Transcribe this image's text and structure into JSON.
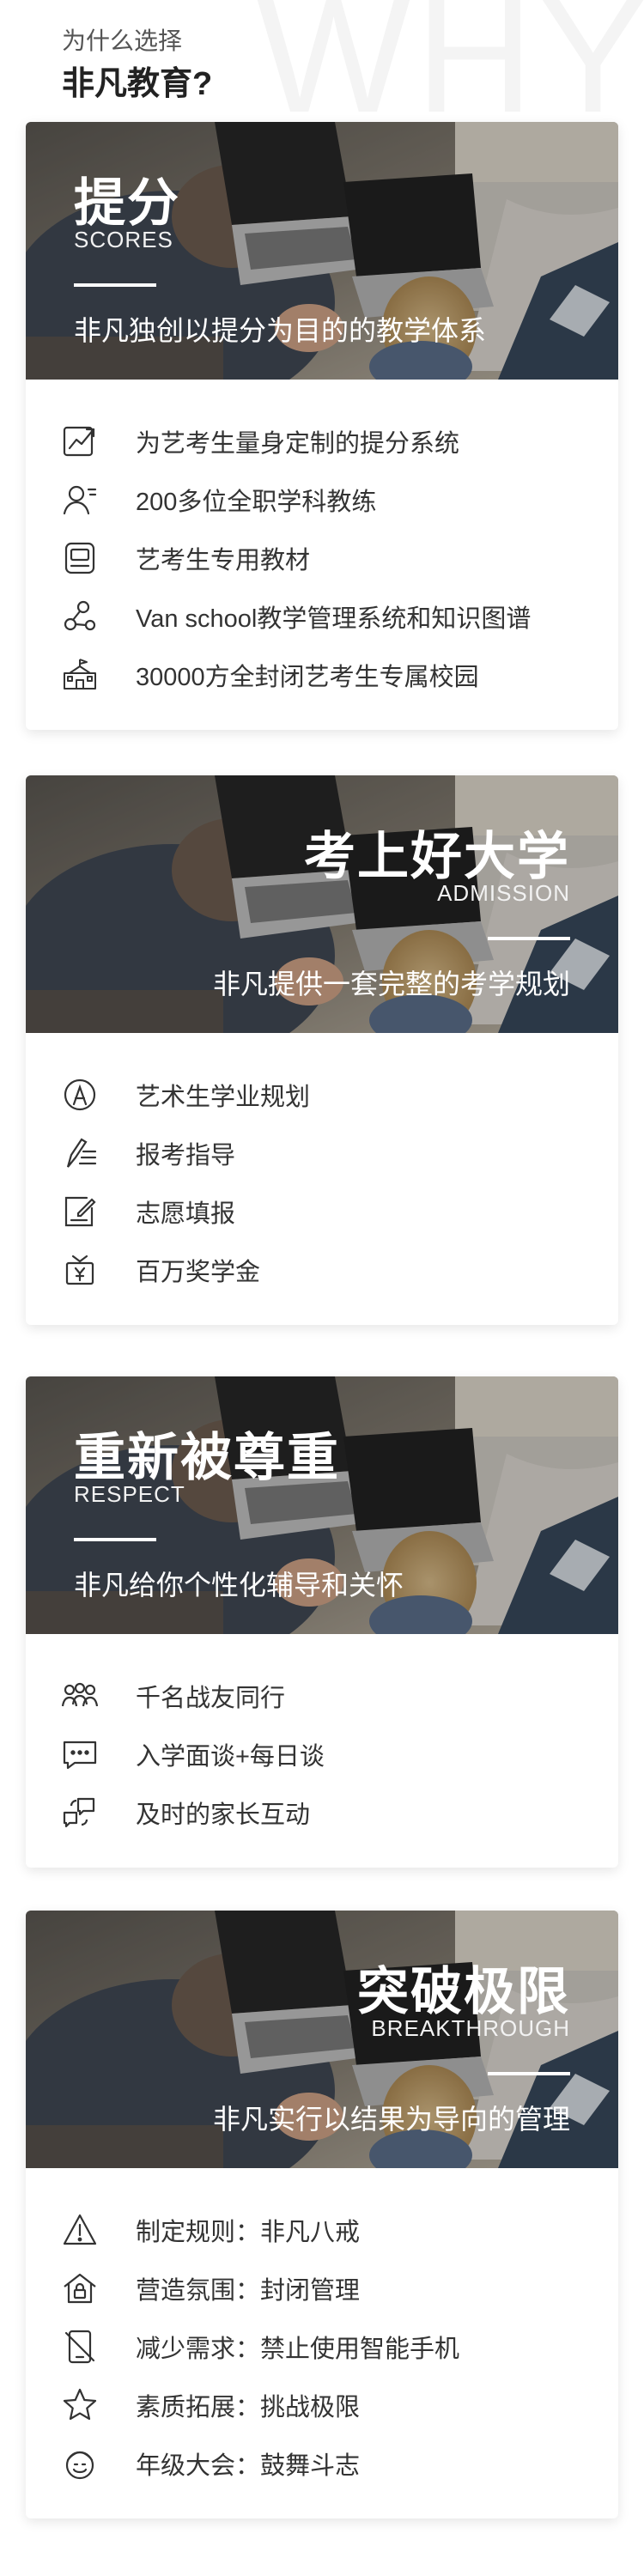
{
  "header": {
    "subtitle": "为什么选择",
    "title": "非凡教育?",
    "watermark": "WHY"
  },
  "cards": [
    {
      "title": "提分",
      "title_en": "SCORES",
      "desc": "非凡独创以提分为目的的教学体系",
      "align": "left",
      "items": [
        {
          "icon": "trend-chart-icon",
          "text": "为艺考生量身定制的提分系统"
        },
        {
          "icon": "teacher-icon",
          "text": "200多位全职学科教练"
        },
        {
          "icon": "book-icon",
          "text": "艺考生专用教材"
        },
        {
          "icon": "network-icon",
          "text": "Van school教学管理系统和知识图谱"
        },
        {
          "icon": "school-building-icon",
          "text": "30000方全封闭艺考生专属校园"
        }
      ]
    },
    {
      "title": "考上好大学",
      "title_en": "ADMISSION",
      "desc": "非凡提供一套完整的考学规划",
      "align": "right",
      "items": [
        {
          "icon": "compass-icon",
          "text": "艺术生学业规划"
        },
        {
          "icon": "guide-pen-icon",
          "text": "报考指导"
        },
        {
          "icon": "form-edit-icon",
          "text": "志愿填报"
        },
        {
          "icon": "money-bag-icon",
          "text": "百万奖学金"
        }
      ]
    },
    {
      "title": "重新被尊重",
      "title_en": "RESPECT",
      "desc": "非凡给你个性化辅导和关怀",
      "align": "left",
      "items": [
        {
          "icon": "group-icon",
          "text": "千名战友同行"
        },
        {
          "icon": "chat-bubble-icon",
          "text": "入学面谈+每日谈"
        },
        {
          "icon": "exchange-icon",
          "text": "及时的家长互动"
        }
      ]
    },
    {
      "title": "突破极限",
      "title_en": "BREAKTHROUGH",
      "desc": "非凡实行以结果为导向的管理",
      "align": "right",
      "items": [
        {
          "icon": "warning-icon",
          "text": "制定规则：非凡八戒"
        },
        {
          "icon": "home-lock-icon",
          "text": "营造氛围：封闭管理"
        },
        {
          "icon": "no-phone-icon",
          "text": "减少需求：禁止使用智能手机"
        },
        {
          "icon": "star-icon",
          "text": "素质拓展：挑战极限"
        },
        {
          "icon": "cheer-face-icon",
          "text": "年级大会：鼓舞斗志"
        }
      ]
    }
  ]
}
